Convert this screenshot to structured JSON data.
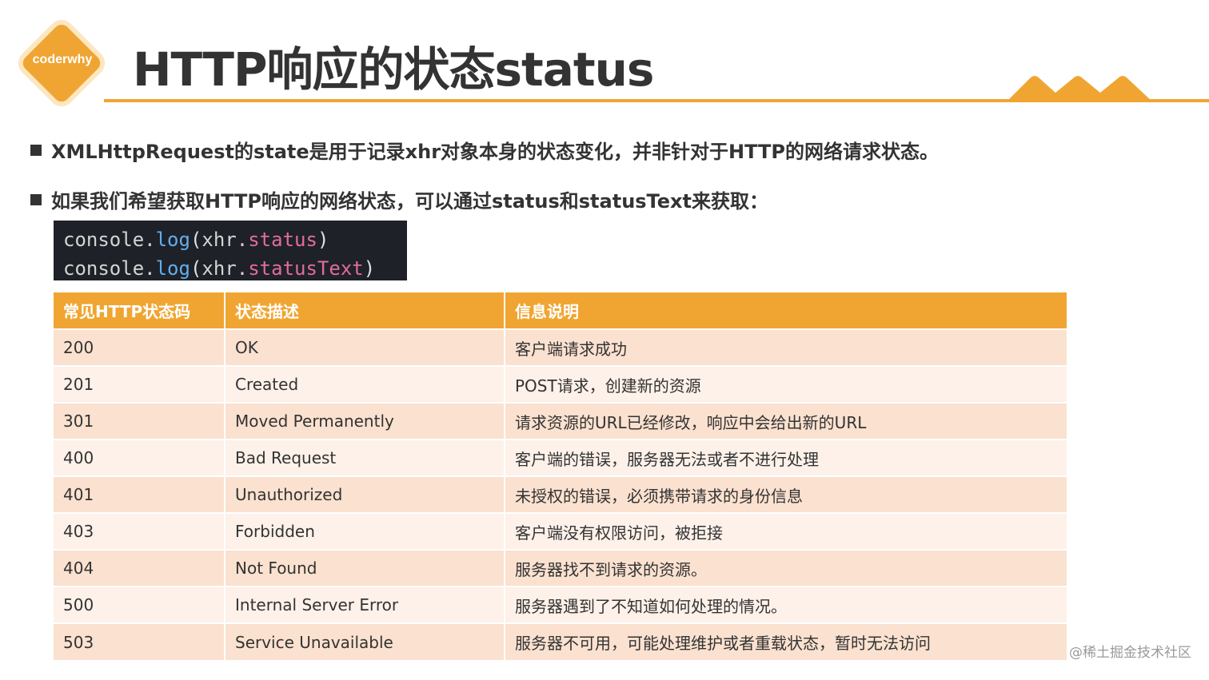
{
  "logo": {
    "text": "coderwhy"
  },
  "title": "HTTP响应的状态status",
  "bullets": [
    "XMLHttpRequest的state是用于记录xhr对象本身的状态变化，并非针对于HTTP的网络请求状态。",
    "如果我们希望获取HTTP响应的网络状态，可以通过status和statusText来获取："
  ],
  "code": {
    "line1": {
      "obj": "console",
      "fn": "log",
      "var": "xhr",
      "prop": "status"
    },
    "line2": {
      "obj": "console",
      "fn": "log",
      "var": "xhr",
      "prop": "statusText"
    }
  },
  "table": {
    "headers": [
      "常见HTTP状态码",
      "状态描述",
      "信息说明"
    ],
    "rows": [
      [
        "200",
        "OK",
        "客户端请求成功"
      ],
      [
        "201",
        "Created",
        "POST请求，创建新的资源"
      ],
      [
        "301",
        "Moved Permanently",
        "请求资源的URL已经修改，响应中会给出新的URL"
      ],
      [
        "400",
        "Bad Request",
        "客户端的错误，服务器无法或者不进行处理"
      ],
      [
        "401",
        "Unauthorized",
        "未授权的错误，必须携带请求的身份信息"
      ],
      [
        "403",
        "Forbidden",
        "客户端没有权限访问，被拒接"
      ],
      [
        "404",
        "Not Found",
        "服务器找不到请求的资源。"
      ],
      [
        "500",
        "Internal Server Error",
        "服务器遇到了不知道如何处理的情况。"
      ],
      [
        "503",
        "Service Unavailable",
        "服务器不可用，可能处理维护或者重载状态，暂时无法访问"
      ]
    ]
  },
  "watermark": "@稀土掘金技术社区",
  "colors": {
    "accent": "#f0a532",
    "code_bg": "#1f2128"
  }
}
